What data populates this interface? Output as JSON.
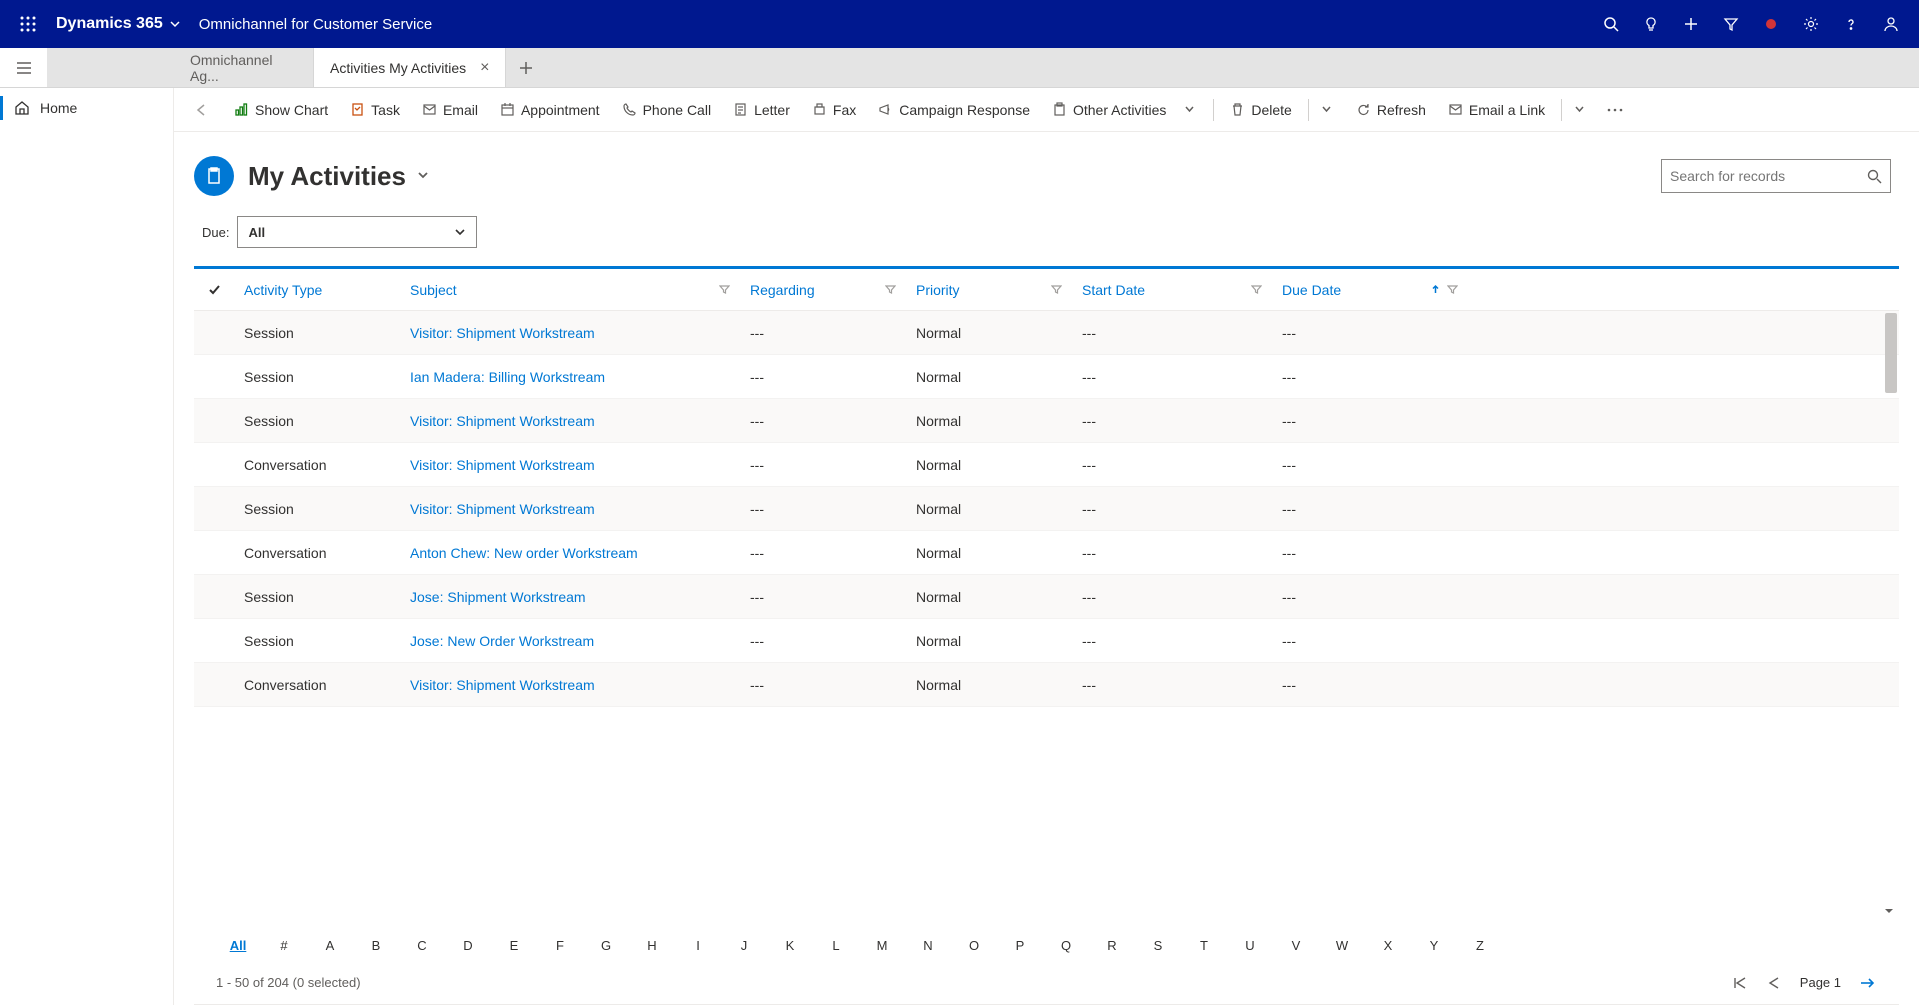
{
  "header": {
    "brand": "Dynamics 365",
    "app_title": "Omnichannel for Customer Service"
  },
  "tabs": {
    "inactive": "Omnichannel Ag...",
    "active": "Activities My Activities"
  },
  "sidebar": {
    "home": "Home"
  },
  "commands": {
    "show_chart": "Show Chart",
    "task": "Task",
    "email": "Email",
    "appointment": "Appointment",
    "phone_call": "Phone Call",
    "letter": "Letter",
    "fax": "Fax",
    "campaign_response": "Campaign Response",
    "other_activities": "Other Activities",
    "delete": "Delete",
    "refresh": "Refresh",
    "email_a_link": "Email a Link"
  },
  "view": {
    "title": "My Activities",
    "search_placeholder": "Search for records"
  },
  "due_filter": {
    "label": "Due:",
    "value": "All"
  },
  "columns": {
    "activity_type": "Activity Type",
    "subject": "Subject",
    "regarding": "Regarding",
    "priority": "Priority",
    "start_date": "Start Date",
    "due_date": "Due Date"
  },
  "rows": [
    {
      "type": "Session",
      "subject": "Visitor: Shipment Workstream",
      "regarding": "---",
      "priority": "Normal",
      "start": "---",
      "due": "---"
    },
    {
      "type": "Session",
      "subject": "Ian Madera: Billing Workstream",
      "regarding": "---",
      "priority": "Normal",
      "start": "---",
      "due": "---"
    },
    {
      "type": "Session",
      "subject": "Visitor: Shipment Workstream",
      "regarding": "---",
      "priority": "Normal",
      "start": "---",
      "due": "---"
    },
    {
      "type": "Conversation",
      "subject": "Visitor: Shipment Workstream",
      "regarding": "---",
      "priority": "Normal",
      "start": "---",
      "due": "---"
    },
    {
      "type": "Session",
      "subject": "Visitor: Shipment Workstream",
      "regarding": "---",
      "priority": "Normal",
      "start": "---",
      "due": "---"
    },
    {
      "type": "Conversation",
      "subject": "Anton Chew: New order Workstream",
      "regarding": "---",
      "priority": "Normal",
      "start": "---",
      "due": "---"
    },
    {
      "type": "Session",
      "subject": "Jose: Shipment Workstream",
      "regarding": "---",
      "priority": "Normal",
      "start": "---",
      "due": "---"
    },
    {
      "type": "Session",
      "subject": "Jose: New Order Workstream",
      "regarding": "---",
      "priority": "Normal",
      "start": "---",
      "due": "---"
    },
    {
      "type": "Conversation",
      "subject": "Visitor: Shipment Workstream",
      "regarding": "---",
      "priority": "Normal",
      "start": "---",
      "due": "---"
    }
  ],
  "alpha_filter": [
    "All",
    "#",
    "A",
    "B",
    "C",
    "D",
    "E",
    "F",
    "G",
    "H",
    "I",
    "J",
    "K",
    "L",
    "M",
    "N",
    "O",
    "P",
    "Q",
    "R",
    "S",
    "T",
    "U",
    "V",
    "W",
    "X",
    "Y",
    "Z"
  ],
  "footer": {
    "status": "1 - 50 of 204 (0 selected)",
    "page": "Page 1"
  }
}
